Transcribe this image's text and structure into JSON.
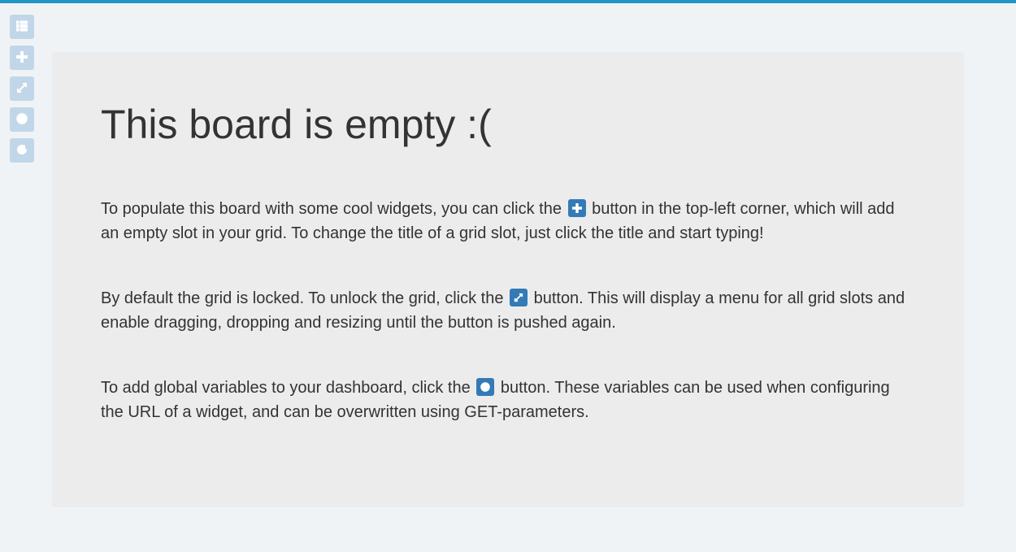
{
  "toolbar": {
    "items": [
      {
        "name": "list-button",
        "icon": "list-icon"
      },
      {
        "name": "add-button",
        "icon": "plus-icon"
      },
      {
        "name": "unlock-button",
        "icon": "expand-icon"
      },
      {
        "name": "globals-button",
        "icon": "globe-icon"
      },
      {
        "name": "refresh-button",
        "icon": "refresh-icon"
      }
    ]
  },
  "empty_state": {
    "heading": "This board is empty :(",
    "p1_a": "To populate this board with some cool widgets, you can click the ",
    "p1_b": " button in the top-left corner, which will add an empty slot in your grid. To change the title of a grid slot, just click the title and start typing!",
    "p2_a": "By default the grid is locked. To unlock the grid, click the ",
    "p2_b": " button. This will display a menu for all grid slots and enable dragging, dropping and resizing until the button is pushed again.",
    "p3_a": "To add global variables to your dashboard, click the ",
    "p3_b": " button. These variables can be used when configuring the URL of a widget, and can be overwritten using GET-parameters."
  },
  "colors": {
    "accent": "#2196c4",
    "toolbar_btn": "#c1d7e9",
    "inline_btn": "#337ab7",
    "panel_bg": "#ececec",
    "page_bg": "#f0f3f6"
  }
}
